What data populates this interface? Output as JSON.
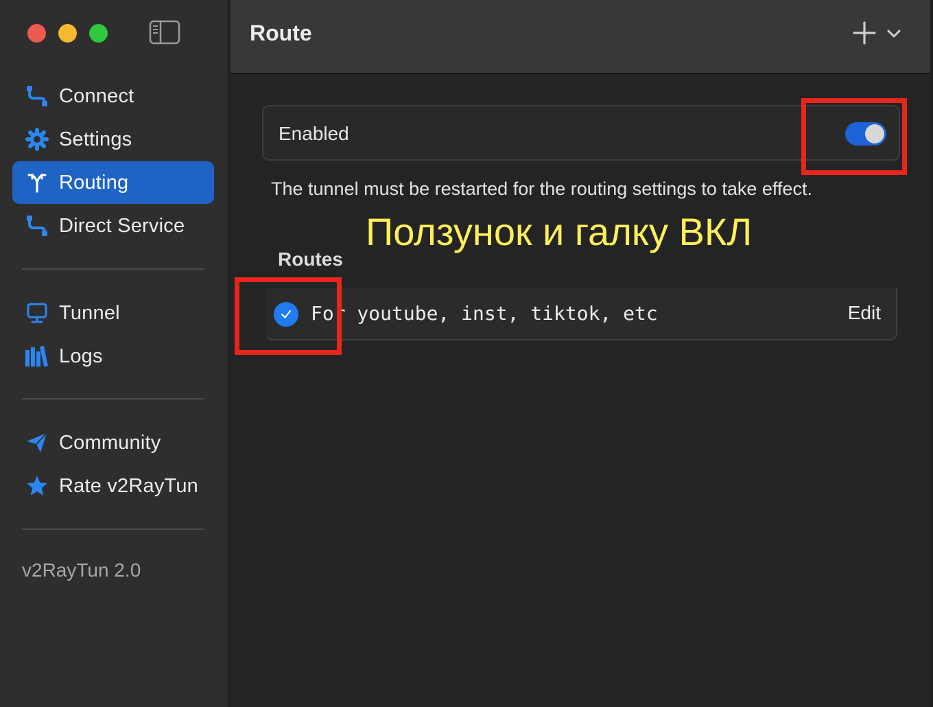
{
  "sidebar": {
    "items": [
      {
        "label": "Connect",
        "icon": "connect-icon"
      },
      {
        "label": "Settings",
        "icon": "gear-icon"
      },
      {
        "label": "Routing",
        "icon": "routing-icon",
        "active": true
      },
      {
        "label": "Direct Service",
        "icon": "direct-service-icon"
      },
      {
        "label": "Tunnel",
        "icon": "monitor-icon"
      },
      {
        "label": "Logs",
        "icon": "logs-icon"
      },
      {
        "label": "Community",
        "icon": "paper-plane-icon"
      },
      {
        "label": "Rate v2RayTun",
        "icon": "star-icon"
      }
    ],
    "version": "v2RayTun 2.0"
  },
  "header": {
    "title": "Route"
  },
  "main": {
    "enabled_label": "Enabled",
    "enabled": true,
    "notice": "The tunnel must be restarted for the routing settings to take effect.",
    "annotation": "Ползунок и галку ВКЛ",
    "routes_header": "Routes",
    "routes": [
      {
        "name": "For youtube, inst, tiktok, etc",
        "checked": true,
        "edit_label": "Edit"
      }
    ]
  },
  "colors": {
    "accent": "#1f64c5",
    "toggle_on": "#1d62d6",
    "check": "#1f7cf2",
    "highlight": "#e8261b",
    "annotation": "#fff05a"
  }
}
